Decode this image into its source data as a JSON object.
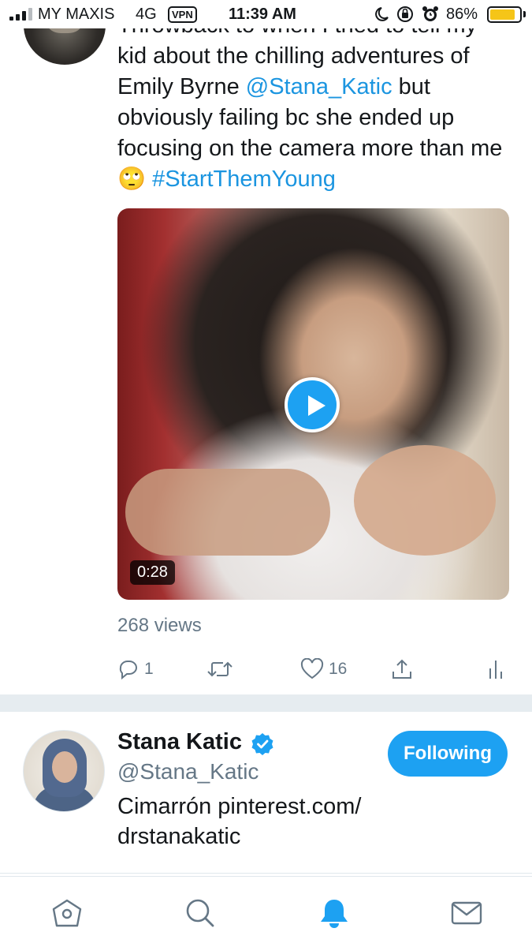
{
  "status_bar": {
    "carrier": "MY MAXIS",
    "network": "4G",
    "vpn": "VPN",
    "time": "11:39 AM",
    "battery": "86%",
    "battery_level": 0.86,
    "battery_color": "#f5c518",
    "icons": [
      "signal-icon",
      "moon-icon",
      "orientation-lock-icon",
      "alarm-icon",
      "battery-icon"
    ]
  },
  "tweet": {
    "text_clipped": "Throwback to when I tried to tell my",
    "text_1": "kid about the chilling adventures of Emily Byrne ",
    "mention": "@Stana_Katic",
    "text_2": " but obviously failing bc she ended up focusing on the camera more than me ",
    "emoji": "🙄",
    "hashtag": "#StartThemYoung",
    "video_duration": "0:28",
    "views": "268 views",
    "actions": {
      "replies": "1",
      "retweets": "",
      "likes": "16"
    }
  },
  "user_card": {
    "name": "Stana Katic",
    "handle": "@Stana_Katic",
    "bio_line1": "Cimarrón pinterest.com/",
    "bio_line2": "drstanakatic",
    "follow_label": "Following",
    "accent_color": "#1da1f2"
  },
  "tabbar": {
    "tabs": [
      "home-icon",
      "search-icon",
      "notifications-icon",
      "messages-icon"
    ],
    "active": "notifications-icon"
  }
}
